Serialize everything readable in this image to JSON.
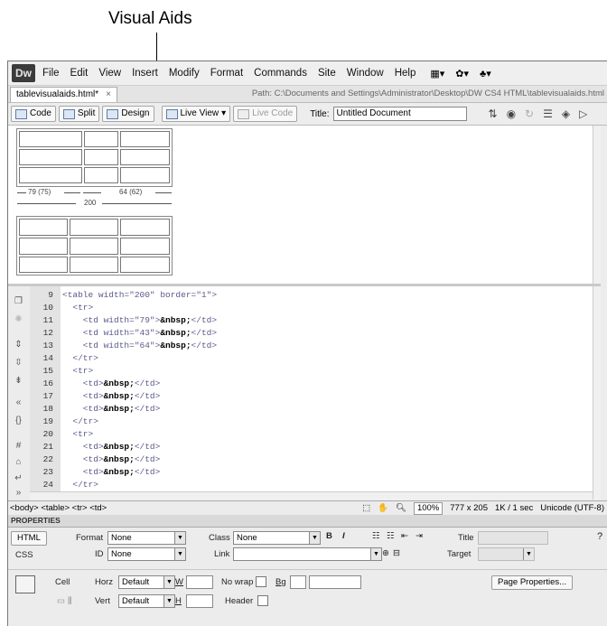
{
  "callout": {
    "label": "Visual Aids"
  },
  "app": {
    "logo": "Dw",
    "menu": [
      "File",
      "Edit",
      "View",
      "Insert",
      "Modify",
      "Format",
      "Commands",
      "Site",
      "Window",
      "Help"
    ]
  },
  "tab": {
    "name": "tablevisualaids.html*",
    "close": "×",
    "path": "Path: C:\\Documents and Settings\\Administrator\\Desktop\\DW CS4 HTML\\tablevisualaids.html"
  },
  "toolbar": {
    "code": "Code",
    "split": "Split",
    "design": "Design",
    "live_view": "Live View",
    "live_code": "Live Code",
    "title_label": "Title:",
    "title_value": "Untitled Document"
  },
  "design_view": {
    "left_width": "79 (75)",
    "right_width": "64 (62)",
    "total_width": "200"
  },
  "code": {
    "lines": [
      {
        "n": "9",
        "pre": "<table width=\"200\" border=\"1\">",
        "ent": "",
        "post": "",
        "indent": ""
      },
      {
        "n": "10",
        "pre": "<tr>",
        "ent": "",
        "post": "",
        "indent": "  "
      },
      {
        "n": "11",
        "pre": "<td width=\"79\">",
        "ent": "&nbsp;",
        "post": "</td>",
        "indent": "    "
      },
      {
        "n": "12",
        "pre": "<td width=\"43\">",
        "ent": "&nbsp;",
        "post": "</td>",
        "indent": "    "
      },
      {
        "n": "13",
        "pre": "<td width=\"64\">",
        "ent": "&nbsp;",
        "post": "</td>",
        "indent": "    "
      },
      {
        "n": "14",
        "pre": "</tr>",
        "ent": "",
        "post": "",
        "indent": "  "
      },
      {
        "n": "15",
        "pre": "<tr>",
        "ent": "",
        "post": "",
        "indent": "  "
      },
      {
        "n": "16",
        "pre": "<td>",
        "ent": "&nbsp;",
        "post": "</td>",
        "indent": "    "
      },
      {
        "n": "17",
        "pre": "<td>",
        "ent": "&nbsp;",
        "post": "</td>",
        "indent": "    "
      },
      {
        "n": "18",
        "pre": "<td>",
        "ent": "&nbsp;",
        "post": "</td>",
        "indent": "    "
      },
      {
        "n": "19",
        "pre": "</tr>",
        "ent": "",
        "post": "",
        "indent": "  "
      },
      {
        "n": "20",
        "pre": "<tr>",
        "ent": "",
        "post": "",
        "indent": "  "
      },
      {
        "n": "21",
        "pre": "<td>",
        "ent": "&nbsp;",
        "post": "</td>",
        "indent": "    "
      },
      {
        "n": "22",
        "pre": "<td>",
        "ent": "&nbsp;",
        "post": "</td>",
        "indent": "    "
      },
      {
        "n": "23",
        "pre": "<td>",
        "ent": "&nbsp;",
        "post": "</td>",
        "indent": "    "
      },
      {
        "n": "24",
        "pre": "</tr>",
        "ent": "",
        "post": "",
        "indent": "  "
      }
    ]
  },
  "status": {
    "breadcrumb": "<body> <table> <tr> <td>",
    "zoom": "100%",
    "size": "777 x 205",
    "download": "1K / 1 sec",
    "encoding": "Unicode (UTF-8)"
  },
  "properties": {
    "header": "PROPERTIES",
    "html_btn": "HTML",
    "css_btn": "CSS",
    "format_label": "Format",
    "format_value": "None",
    "id_label": "ID",
    "id_value": "None",
    "class_label": "Class",
    "class_value": "None",
    "link_label": "Link",
    "bold": "B",
    "italic": "I",
    "title_label": "Title",
    "target_label": "Target",
    "cell_label": "Cell",
    "horz_label": "Horz",
    "horz_value": "Default",
    "vert_label": "Vert",
    "vert_value": "Default",
    "w_label": "W",
    "h_label": "H",
    "nowrap_label": "No wrap",
    "header_label": "Header",
    "bg_label": "Bg",
    "page_props": "Page Properties..."
  }
}
